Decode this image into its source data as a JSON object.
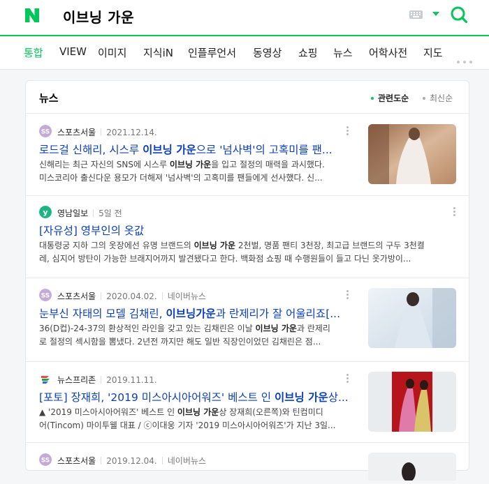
{
  "search": {
    "query": "이브닝 가운"
  },
  "tabs": [
    {
      "label": "통합",
      "active": true
    },
    {
      "label": "VIEW"
    },
    {
      "label": "이미지"
    },
    {
      "label": "지식iN"
    },
    {
      "label": "인플루언서"
    },
    {
      "label": "동영상"
    },
    {
      "label": "쇼핑"
    },
    {
      "label": "뉴스"
    },
    {
      "label": "어학사전"
    },
    {
      "label": "지도"
    }
  ],
  "news": {
    "title": "뉴스",
    "sort_relevance": "관련도순",
    "sort_latest": "최신순",
    "items": [
      {
        "press": "스포츠서울",
        "date": "2021.12.14.",
        "title_a": "로드걸 신해리, 시스루 ",
        "title_hl": "이브닝 가운",
        "title_b": "으로 '넘사벽'의 고혹미를 팬...",
        "desc1_a": "신해리는 최근 자신의 SNS에 시스루 ",
        "desc1_hl": "이브닝 가운",
        "desc1_b": "을 입고 절정의 매력을 과시했다.",
        "desc2": "미스코리아 출신다운 용모가 더해져 '넘사벽'의 고혹미를 팬들에게 선사했다. 신..."
      },
      {
        "press": "영남일보",
        "date": "5일 전",
        "title": "[자유성] 영부인의 옷값",
        "desc1_a": "대통령궁 지하 그의 옷장에선 유명 브랜드의 ",
        "desc1_hl": "이브닝 가운",
        "desc1_b": " 2천벌, 명품 팬티 3천장, 최고급 브랜드의 구두 3천켤",
        "desc2": "레, 심지어 방탄이 가능한 브래지어까지 발견됐다고 한다. 백화점 쇼핑 때 수행원들이 들고 다닌 옷가방이..."
      },
      {
        "press": "스포츠서울",
        "date": "2020.04.02.",
        "extra": "네이버뉴스",
        "title_a": "눈부신 자태의 모델 김채린, ",
        "title_hl": "이브닝가운",
        "title_b": "과 란제리가 잘 어울리죠[...",
        "desc1_a": "36(D컵)-24-37의 환상적인 라인을 갖고 있는 김채린은 이날 ",
        "desc1_hl": "이브닝 가운",
        "desc1_b": "과 란제리",
        "desc2": "로 절정의 섹시함을 뽐냈다. 2년전 까지만 해도 일반 직장인이었던 김채린은 점..."
      },
      {
        "press": "뉴스프리존",
        "date": "2019.11.11.",
        "title_a": "[포토] 장재희, '2019 미스아시아어워즈' 베스트 인 ",
        "title_hl": "이브닝 가운",
        "title_b": "상...",
        "desc1_a": "▲ '2019 미스아시아어워즈' 베스트 인 ",
        "desc1_hl": "이브닝 가운",
        "desc1_b": "상 장재희(오른쪽)와 틴컴미디",
        "desc2": "어(Tincom) 마이투웰 대표 / ⓒ이대웅 기자 '2019 미스아시아어워즈'가 지난 3일..."
      },
      {
        "press": "스포츠서울",
        "date": "2019.12.04.",
        "extra": "네이버뉴스"
      }
    ]
  },
  "colors": {
    "accent": "#03c75a",
    "link": "#0b3ebd"
  }
}
